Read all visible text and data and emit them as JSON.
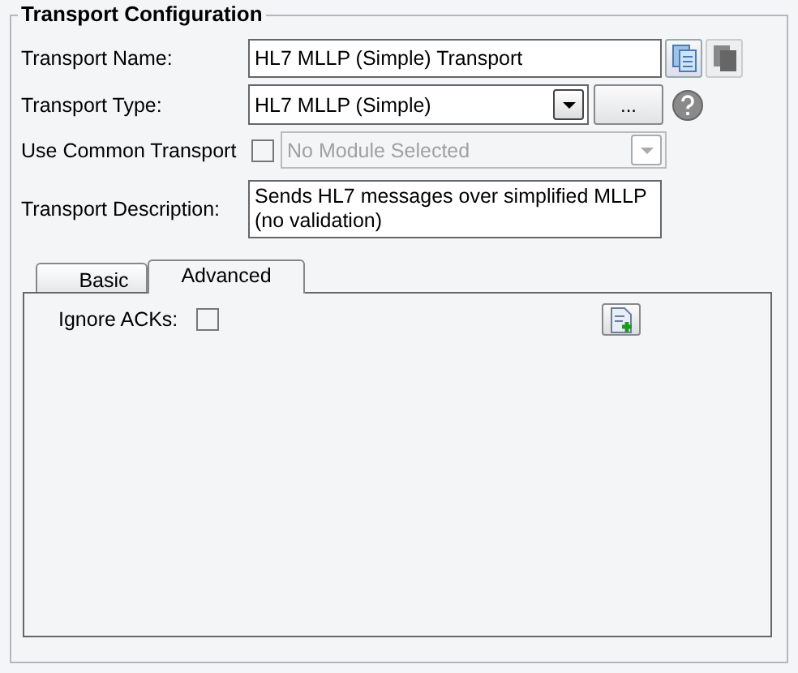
{
  "group": {
    "title": "Transport Configuration"
  },
  "fields": [
    {
      "kind": "text",
      "label": "Transport Name:",
      "value": "HL7 MLLP (Simple) Transport"
    },
    {
      "kind": "select",
      "label": "Transport Type:",
      "value": "HL7 MLLP (Simple)",
      "button": "..."
    },
    {
      "kind": "common",
      "label": "Use Common Transport",
      "checked": false,
      "value": "No Module Selected",
      "disabled": true
    },
    {
      "kind": "textarea",
      "label": "Transport Description:",
      "value": "Sends HL7 messages over simplified MLLP (no validation)"
    }
  ],
  "tabs": [
    {
      "label": "Basic",
      "selected": false
    },
    {
      "label": "Advanced",
      "selected": true
    }
  ],
  "options": [
    {
      "label": "Ignore ACKs:",
      "checked": false
    }
  ]
}
